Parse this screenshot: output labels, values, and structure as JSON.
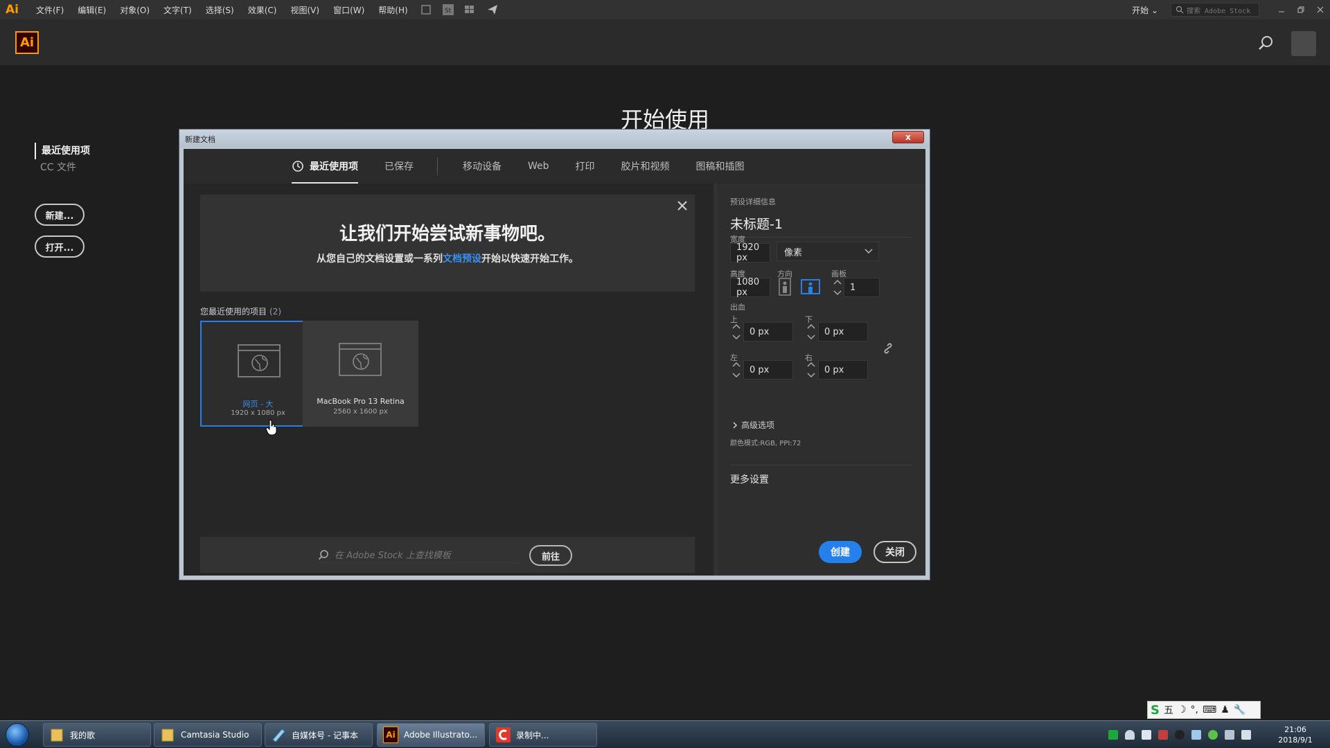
{
  "menubar": {
    "app_mini": "Ai",
    "items": [
      "文件(F)",
      "编辑(E)",
      "对象(O)",
      "文字(T)",
      "选择(S)",
      "效果(C)",
      "视图(V)",
      "窗口(W)",
      "帮助(H)"
    ],
    "workspace": "开始",
    "stock_search_placeholder": "搜索 Adobe Stock"
  },
  "header": {
    "logo": "Ai"
  },
  "start_title": "开始使用",
  "sidebar": {
    "tabs": [
      {
        "label": "最近使用项",
        "active": true
      },
      {
        "label": "CC 文件",
        "active": false
      }
    ],
    "new_button": "新建...",
    "open_button": "打开..."
  },
  "dialog": {
    "title": "新建文档",
    "close_glyph": "x",
    "tabs": [
      {
        "label": "最近使用项",
        "active": true
      },
      {
        "label": "已保存"
      },
      {
        "label": "移动设备"
      },
      {
        "label": "Web"
      },
      {
        "label": "打印"
      },
      {
        "label": "胶片和视频"
      },
      {
        "label": "图稿和插图"
      }
    ],
    "banner": {
      "title": "让我们开始尝试新事物吧。",
      "subtitle_pre": "从您自己的文档设置或一系列",
      "subtitle_link": "文档预设",
      "subtitle_post": "开始以快速开始工作。"
    },
    "recent": {
      "label": "您最近使用的项目",
      "count": "(2)",
      "items": [
        {
          "name": "网页 - 大",
          "size": "1920 x 1080 px",
          "selected": true
        },
        {
          "name": "MacBook Pro 13 Retina",
          "size": "2560 x 1600 px",
          "selected": false
        }
      ]
    },
    "stock": {
      "placeholder": "在 Adobe Stock 上查找模板",
      "go_button": "前往"
    },
    "preset": {
      "section_label": "预设详细信息",
      "doc_name": "未标题-1",
      "width_label": "宽度",
      "width_value": "1920 px",
      "unit": "像素",
      "height_label": "高度",
      "height_value": "1080 px",
      "orientation_label": "方向",
      "artboards_label": "画板",
      "artboards_value": "1",
      "bleed_label": "出血",
      "top_label": "上",
      "bottom_label": "下",
      "left_label": "左",
      "right_label": "右",
      "bleed_top": "0 px",
      "bleed_bottom": "0 px",
      "bleed_left": "0 px",
      "bleed_right": "0 px",
      "advanced_label": "高级选项",
      "color_mode": "颜色模式:RGB, PPI:72",
      "more_settings": "更多设置",
      "create_button": "创建",
      "close_button": "关闭"
    }
  },
  "ime": {
    "mode": "五",
    "logo": "S"
  },
  "taskbar": {
    "buttons": [
      {
        "label": "我的歌"
      },
      {
        "label": "Camtasia Studio"
      },
      {
        "label": "自媒体号 - 记事本"
      },
      {
        "label": "Adobe Illustrato...",
        "icon_text": "Ai"
      },
      {
        "label": "录制中..."
      }
    ],
    "time": "21:06",
    "date": "2018/9/1"
  },
  "colors": {
    "accent": "#2680eb",
    "ai_orange": "#ff9a00",
    "background": "#1e1e1e"
  }
}
